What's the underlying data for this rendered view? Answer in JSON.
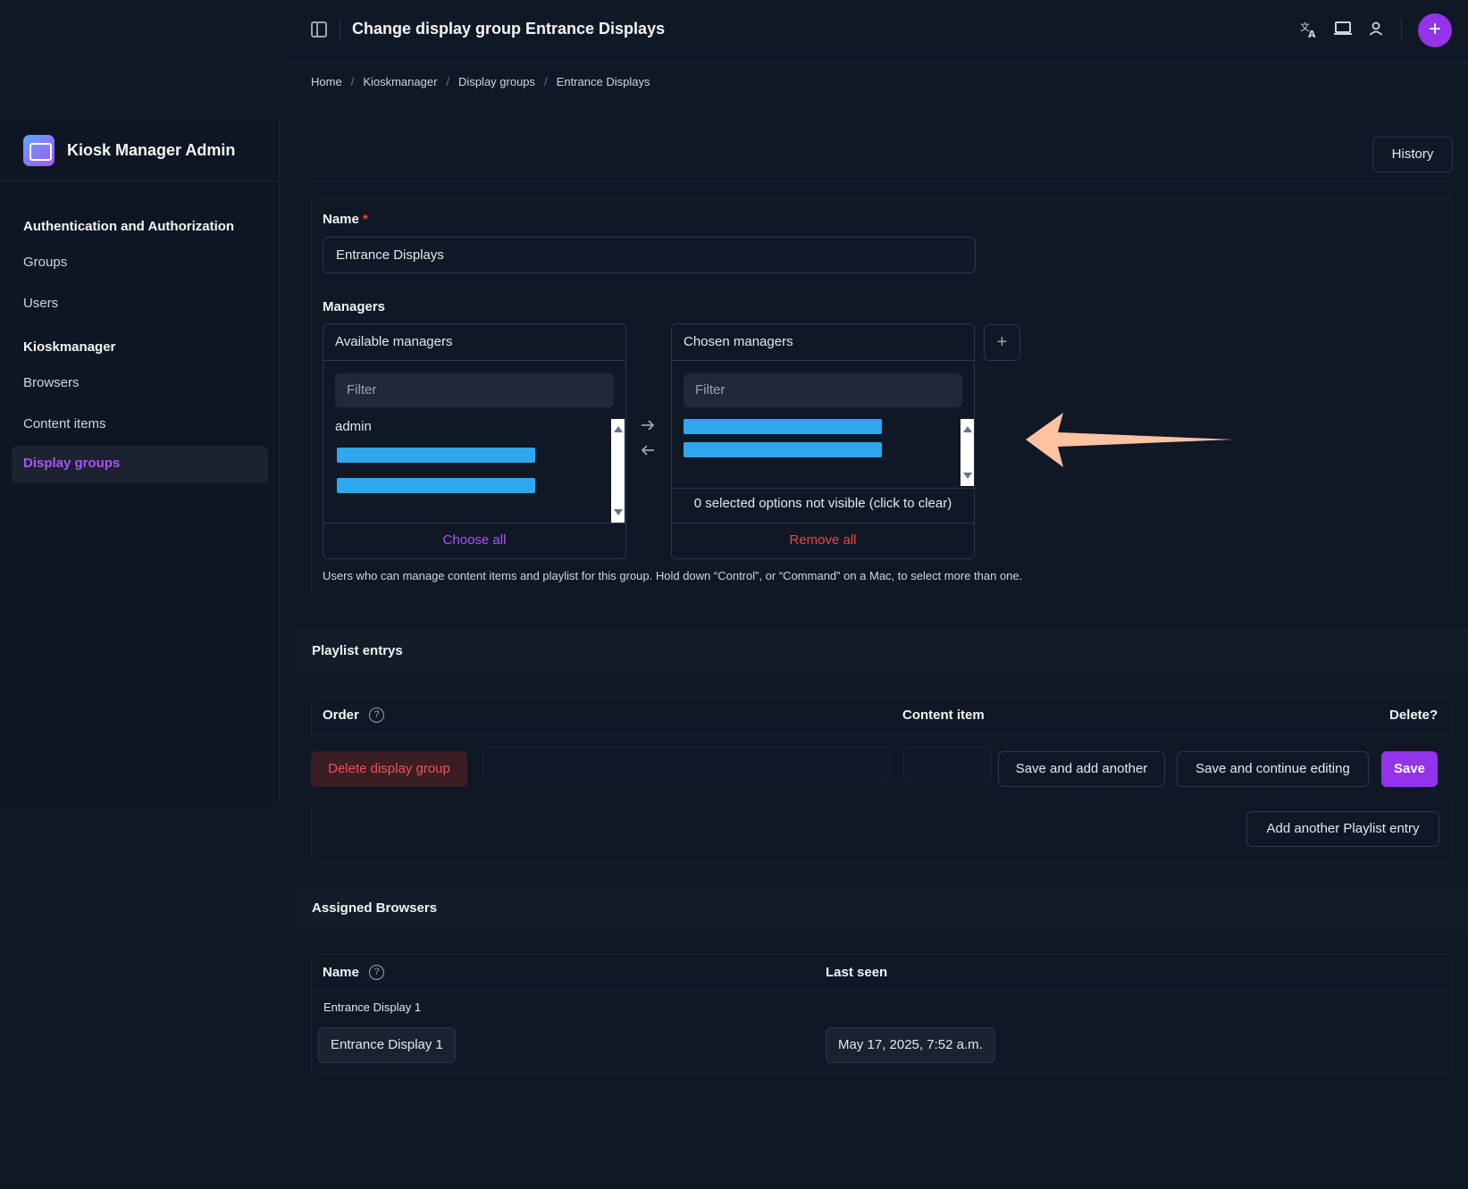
{
  "header": {
    "title": "Change display group Entrance Displays",
    "icons": [
      "sidebar-toggle-icon",
      "translate-icon",
      "monitor-icon",
      "user-icon",
      "plus-icon"
    ]
  },
  "breadcrumb": [
    "Home",
    "Kioskmanager",
    "Display groups",
    "Entrance Displays"
  ],
  "sidebar": {
    "brand": "Kiosk Manager Admin",
    "sections": [
      {
        "heading": "Authentication and Authorization",
        "items": [
          "Groups",
          "Users"
        ]
      },
      {
        "heading": "Kioskmanager",
        "items": [
          "Browsers",
          "Content items",
          "Display groups"
        ]
      }
    ],
    "active": "Display groups"
  },
  "history_label": "History",
  "form": {
    "name_label": "Name",
    "required_mark": "*",
    "name_value": "Entrance Displays",
    "managers_label": "Managers",
    "available": {
      "title": "Available managers",
      "filter_placeholder": "Filter",
      "options": [
        "admin"
      ],
      "choose_all": "Choose all"
    },
    "chosen": {
      "title": "Chosen managers",
      "filter_placeholder": "Filter",
      "not_visible": "0 selected options not visible (click to clear)",
      "remove_all": "Remove all"
    },
    "help_text": "Users who can manage content items and playlist for this group. Hold down “Control”, or “Command” on a Mac, to select more than one."
  },
  "playlist": {
    "title": "Playlist entrys",
    "columns": [
      "Order",
      "Content item",
      "Delete?"
    ],
    "add_label": "Add another Playlist entry"
  },
  "actions": {
    "delete": "Delete display group",
    "save_add": "Save and add another",
    "save_continue": "Save and continue editing",
    "save": "Save"
  },
  "browsers": {
    "title": "Assigned Browsers",
    "columns": [
      "Name",
      "Last seen"
    ],
    "rows": [
      {
        "caption": "Entrance Display 1",
        "name": "Entrance Display 1",
        "last_seen": "May 17, 2025, 7:52 a.m."
      }
    ]
  },
  "colors": {
    "accent": "#9333ea",
    "danger": "#ef4444",
    "redaction": "#2ea7ee",
    "annotation_arrow": "#fdc3a0"
  }
}
